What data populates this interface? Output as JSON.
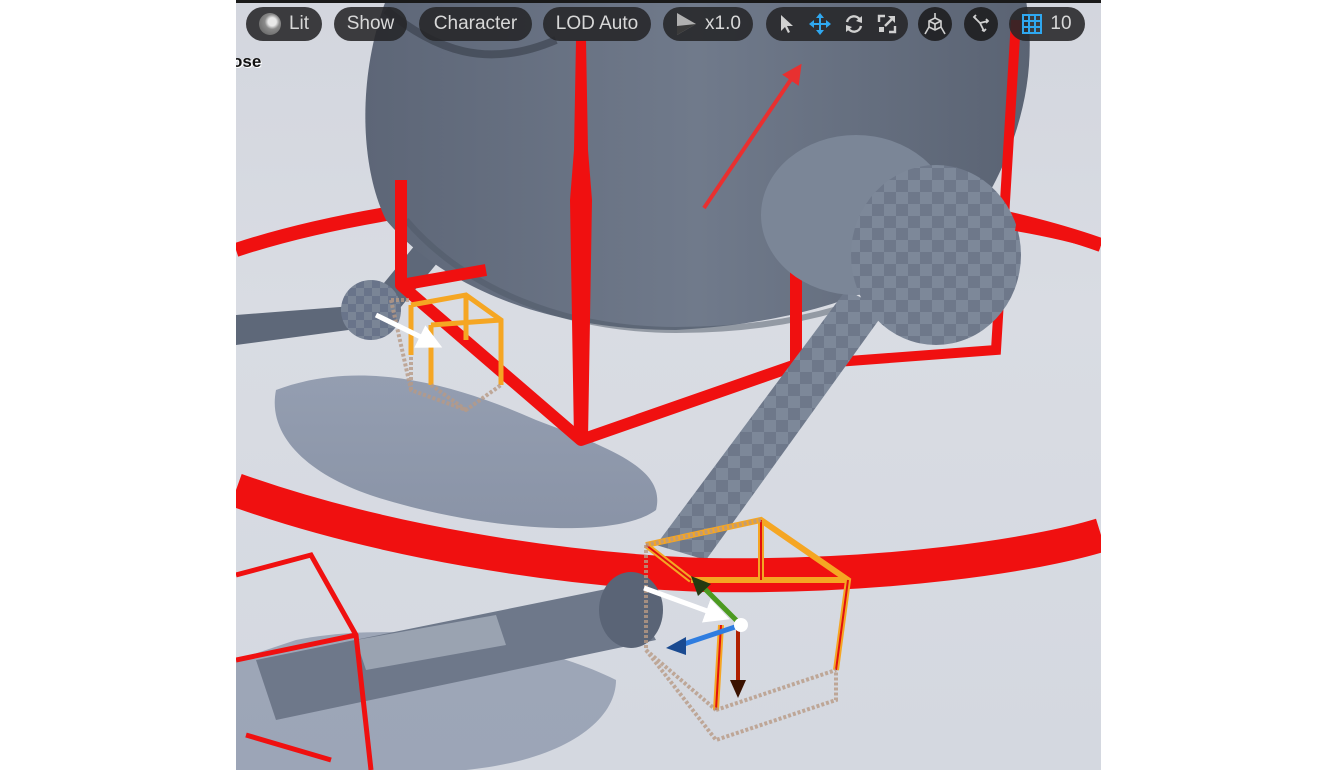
{
  "viewport": {
    "overlay_label": "ose",
    "toolbar": {
      "view_mode": {
        "label": "Lit",
        "icon": "lit-sphere-icon"
      },
      "show": {
        "label": "Show"
      },
      "character": {
        "label": "Character"
      },
      "lod": {
        "label": "LOD Auto"
      },
      "playback": {
        "icon": "play-icon",
        "label": "x1.0"
      },
      "transform_tools": [
        {
          "name": "select",
          "icon": "select-arrow-icon",
          "active": false
        },
        {
          "name": "translate",
          "icon": "translate-icon",
          "active": true
        },
        {
          "name": "rotate",
          "icon": "rotate-icon",
          "active": false
        },
        {
          "name": "scale",
          "icon": "scale-icon",
          "active": false
        }
      ],
      "coordinate_space": {
        "icon": "world-local-space-icon"
      },
      "surface_snap": {
        "icon": "surface-snap-icon"
      },
      "grid_snap": {
        "icon": "grid-snap-icon",
        "label": "10"
      }
    },
    "colors": {
      "accent_active": "#2fa8f0",
      "physics_bodies": "#f01010",
      "constraint_box": "#f5a623",
      "annotation_arrow_red": "#e83030",
      "annotation_arrow_white": "#ffffff",
      "gizmo_x": "#b02000",
      "gizmo_y": "#4c9a20",
      "gizmo_z": "#2f7de0"
    },
    "annotations": [
      {
        "type": "arrow",
        "color": "red",
        "points_to": "transform-toolbar"
      },
      {
        "type": "arrow",
        "color": "white",
        "points_to": "upper-constraint-box"
      },
      {
        "type": "arrow",
        "color": "white",
        "points_to": "lower-constraint-gizmo"
      }
    ]
  }
}
